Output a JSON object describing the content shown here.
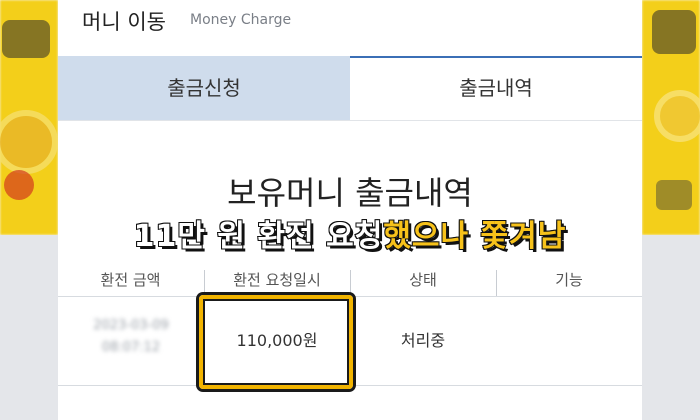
{
  "header": {
    "title_ko": "머니 이동",
    "title_en": "Money Charge"
  },
  "tabs": [
    {
      "label": "출금신청",
      "active": false
    },
    {
      "label": "출금내역",
      "active": true
    }
  ],
  "section_heading": "보유머니 출금내역",
  "table": {
    "columns": [
      "환전 금액",
      "환전 요청일시",
      "상태",
      "기능"
    ],
    "rows": [
      {
        "date": "2023-03-09",
        "time": "08:07:12",
        "amount": "110,000원",
        "status": "처리중",
        "action": ""
      }
    ]
  },
  "caption": {
    "part_white": "11만 원 환전 요청",
    "part_yellow": "했으나 쫓겨남"
  },
  "colors": {
    "highlight": "#f2b400",
    "tab_active_bg": "#cfdcec",
    "caption_yellow": "#f7c21a"
  }
}
